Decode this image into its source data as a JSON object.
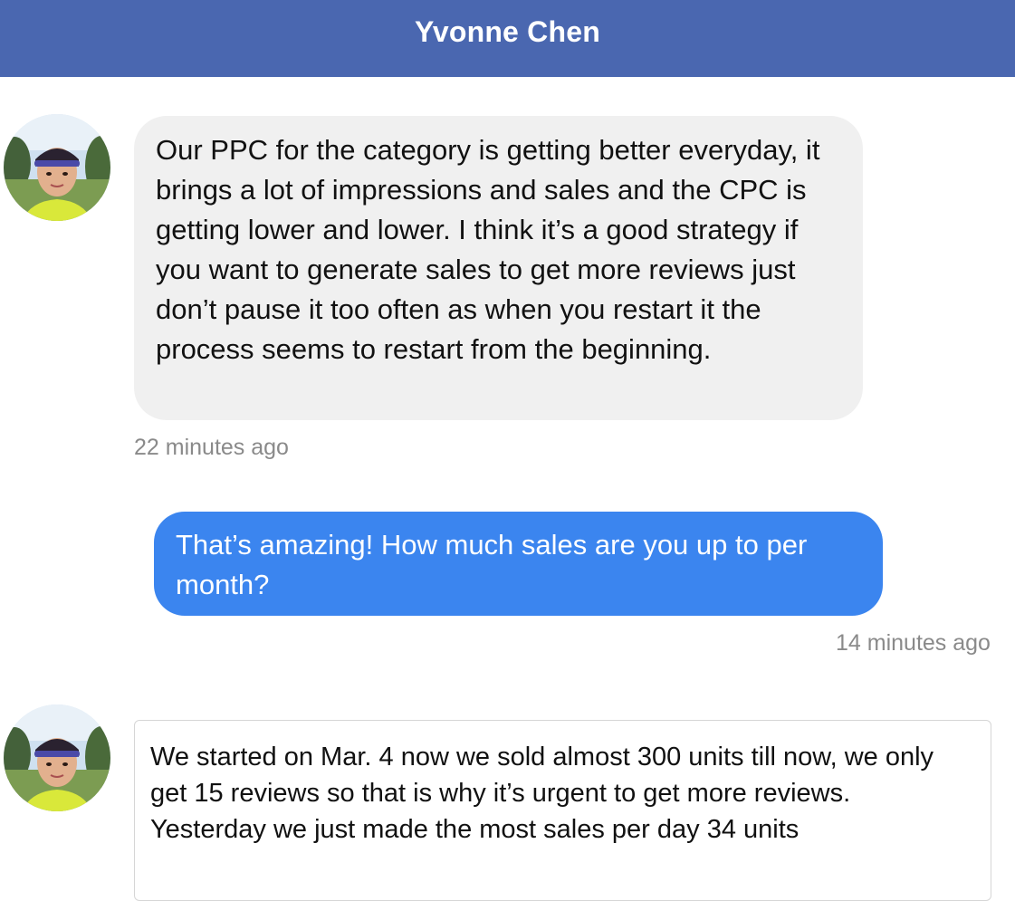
{
  "header": {
    "title": "Yvonne Chen"
  },
  "messages": [
    {
      "direction": "incoming",
      "text": "Our PPC for the category is getting better everyday, it brings a lot of impressions and sales and the CPC is getting lower and lower.  I think it’s a good strategy if you want to generate sales to get more reviews just don’t pause it too often as when you restart it the process seems to restart from the beginning.",
      "timestamp": "22 minutes ago"
    },
    {
      "direction": "outgoing",
      "text": "That’s amazing! How much sales are you up to per month?",
      "timestamp": "14 minutes ago"
    },
    {
      "direction": "incoming",
      "text": "We started on Mar. 4 now we sold almost 300 units till now, we only get 15 reviews so that is why it’s urgent to get more reviews. Yesterday we just made the most sales per day 34 units"
    }
  ],
  "colors": {
    "header_bg": "#4a67b0",
    "incoming_bubble_bg": "#f0f0f0",
    "outgoing_bubble_bg": "#3b85ef",
    "timestamp_text": "#8a8a8a"
  }
}
